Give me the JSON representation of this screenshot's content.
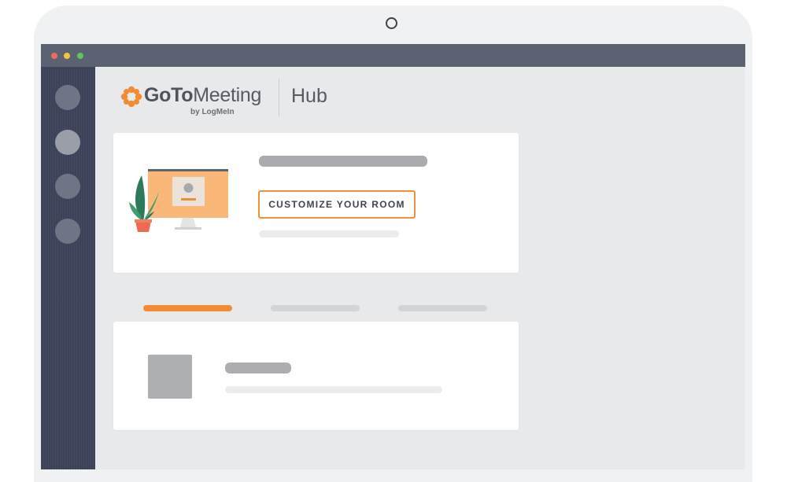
{
  "brand": {
    "logo_main": "GoTo",
    "logo_rest": "Meeting",
    "logo_by": "by LogMeIn",
    "section": "Hub"
  },
  "room_card": {
    "button_label": "CUSTOMIZE YOUR ROOM"
  },
  "colors": {
    "accent": "#f28c34",
    "sidebar": "#3c4358",
    "titlebar": "#5b6271"
  },
  "sidebar": {
    "items": [
      {
        "icon": "nav-circle-icon"
      },
      {
        "icon": "nav-circle-icon",
        "active": true
      },
      {
        "icon": "nav-circle-icon"
      },
      {
        "icon": "nav-circle-icon"
      }
    ]
  },
  "tabs": {
    "count": 3,
    "active_index": 0
  }
}
